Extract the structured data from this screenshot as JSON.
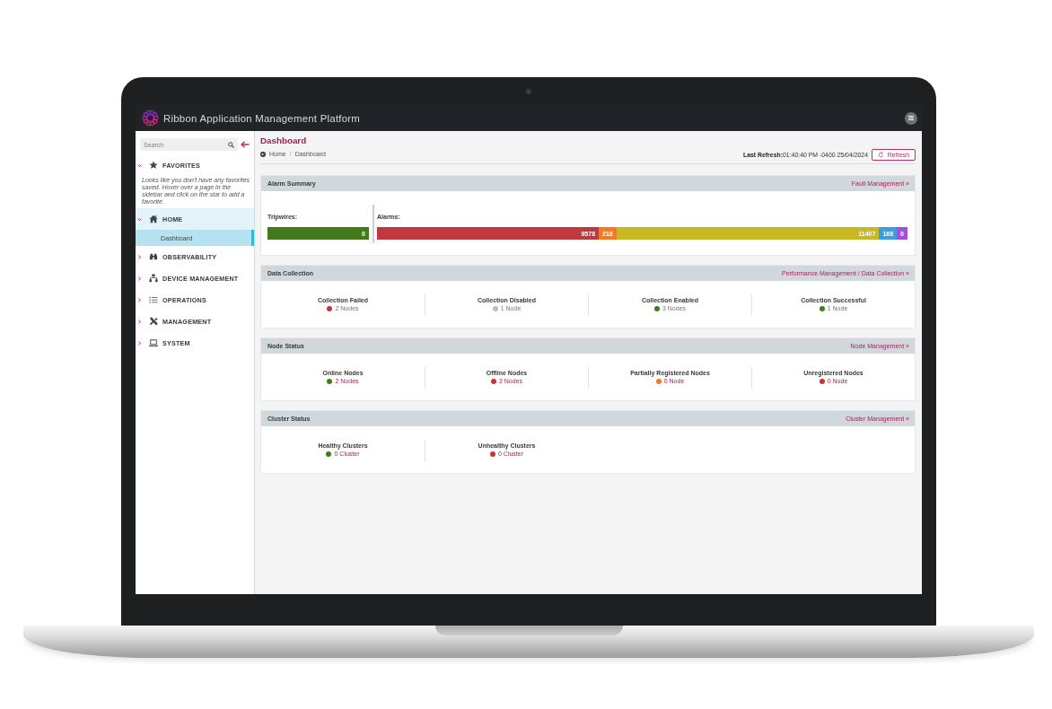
{
  "window": {
    "title": "Ribbon Application Management Platform"
  },
  "sidebar": {
    "search": {
      "placeholder": "Search"
    },
    "sections": [
      {
        "label": "FAVORITES",
        "expanded": true,
        "selected": false,
        "hint": "Looks like you don't have any favorites saved. Hover over a page in the sidebar and click on the star to add a favorite."
      },
      {
        "label": "HOME",
        "expanded": true,
        "selected": true,
        "children": [
          {
            "label": "Dashboard",
            "selected": true
          }
        ]
      },
      {
        "label": "OBSERVABILITY",
        "expanded": false,
        "selected": false
      },
      {
        "label": "DEVICE MANAGEMENT",
        "expanded": false,
        "selected": false
      },
      {
        "label": "OPERATIONS",
        "expanded": false,
        "selected": false
      },
      {
        "label": "MANAGEMENT",
        "expanded": false,
        "selected": false
      },
      {
        "label": "SYSTEM",
        "expanded": false,
        "selected": false
      }
    ]
  },
  "page": {
    "title": "Dashboard",
    "breadcrumb": [
      {
        "label": "Home"
      },
      {
        "label": "Dashboard"
      }
    ],
    "breadcrumb_separator": "/",
    "last_refresh": "**Last Refresh:**01:40:40 PM -0400 25/04/2024",
    "refresh_button": "Refresh"
  },
  "panels": [
    {
      "kind": "alarms",
      "title": "Alarm Summary",
      "link": "Fault Management »",
      "meters": [
        {
          "label": "Tripwires:",
          "segments": [
            {
              "value": "0",
              "color": "#447a1b"
            }
          ]
        },
        {
          "label": "Alarms:",
          "segments": [
            {
              "value": "9578",
              "color": "#c1393f"
            },
            {
              "value": "218",
              "color": "#f47c20"
            },
            {
              "value": "11407",
              "color": "#c8b822"
            },
            {
              "value": "168",
              "color": "#3a9fdd"
            },
            {
              "value": "0",
              "color": "#a74fdc"
            }
          ]
        }
      ]
    },
    {
      "kind": "stats",
      "title": "Data Collection",
      "link": "Performance Management / Data Collection »",
      "items": [
        {
          "label": "Collection Failed",
          "value": "2 Nodes",
          "color": "#c1393f",
          "linked": false
        },
        {
          "label": "Collection Disabled",
          "value": "1 Node",
          "color": "#bdbdbd",
          "linked": false
        },
        {
          "label": "Collection Enabled",
          "value": "3 Nodes",
          "color": "#447a1b",
          "linked": false
        },
        {
          "label": "Collection Successful",
          "value": "1 Node",
          "color": "#447a1b",
          "linked": false
        }
      ]
    },
    {
      "kind": "stats",
      "title": "Node Status",
      "link": "Node Management »",
      "items": [
        {
          "label": "Online Nodes",
          "value": "2 Nodes",
          "color": "#447a1b",
          "linked": true
        },
        {
          "label": "Offline Nodes",
          "value": "2 Nodes",
          "color": "#c1393f",
          "linked": true
        },
        {
          "label": "Partially Registered Nodes",
          "value": "0 Node",
          "color": "#f47c20",
          "linked": true
        },
        {
          "label": "Unregistered Nodes",
          "value": "0 Node",
          "color": "#c1393f",
          "linked": true
        }
      ]
    },
    {
      "kind": "stats",
      "title": "Cluster Status",
      "link": "Cluster Management »",
      "items": [
        {
          "label": "Healthy Clusters",
          "value": "0 Cluster",
          "color": "#447a1b",
          "linked": true
        },
        {
          "label": "Unhealthy Clusters",
          "value": "0 Cluster",
          "color": "#c1393f",
          "linked": true
        }
      ]
    }
  ]
}
